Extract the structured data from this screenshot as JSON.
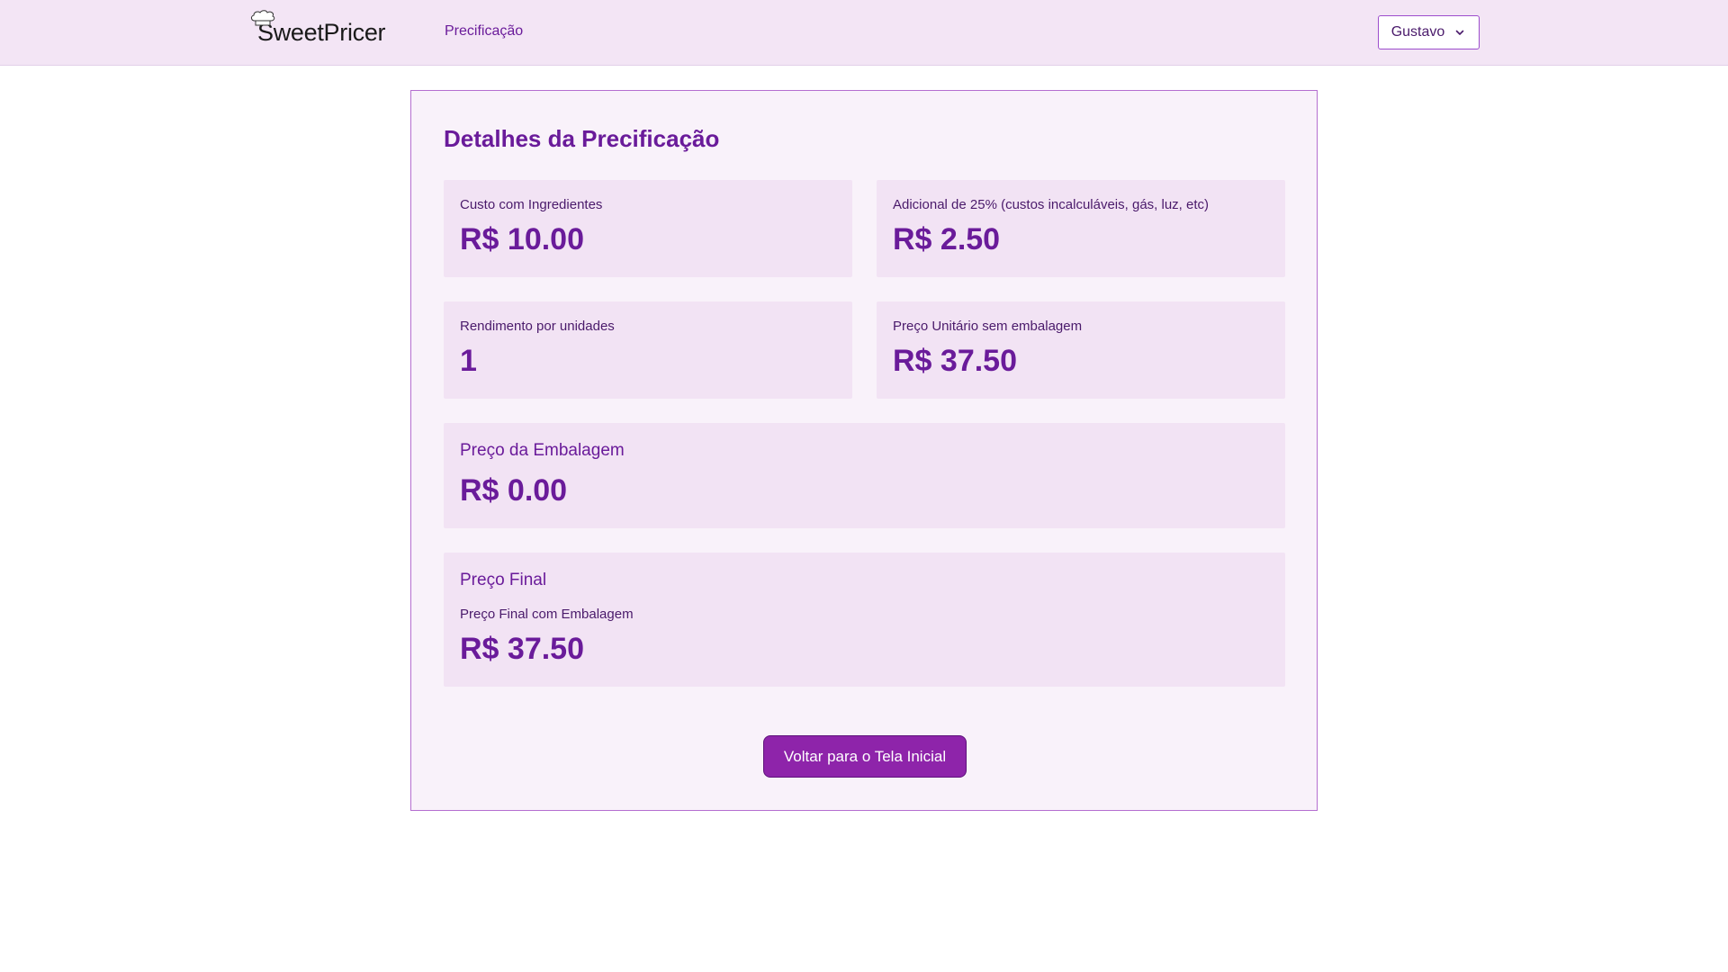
{
  "header": {
    "brand": "SweetPricer",
    "nav_link": "Precificação",
    "user_menu": "Gustavo"
  },
  "details": {
    "title": "Detalhes da Precificação",
    "ingredients": {
      "label": "Custo com Ingredientes",
      "value": "R$ 10.00"
    },
    "additional": {
      "label": "Adicional de 25% (custos incalculáveis, gás, luz, etc)",
      "value": "R$ 2.50"
    },
    "yield": {
      "label": "Rendimento por unidades",
      "value": "1"
    },
    "unit_price": {
      "label": "Preço Unitário sem embalagem",
      "value": "R$ 37.50"
    },
    "packaging": {
      "heading": "Preço da Embalagem",
      "value": "R$ 0.00"
    },
    "final": {
      "heading": "Preço Final",
      "label": "Preço Final com Embalagem",
      "value": "R$ 37.50"
    },
    "back_button": "Voltar para o Tela Inicial"
  },
  "colors": {
    "navbar_bg": "#f3e5f5",
    "card_bg": "#f9f2fa",
    "box_bg": "#f2e3f4",
    "accent": "#6a1b9a",
    "button_bg": "#8e24aa"
  }
}
